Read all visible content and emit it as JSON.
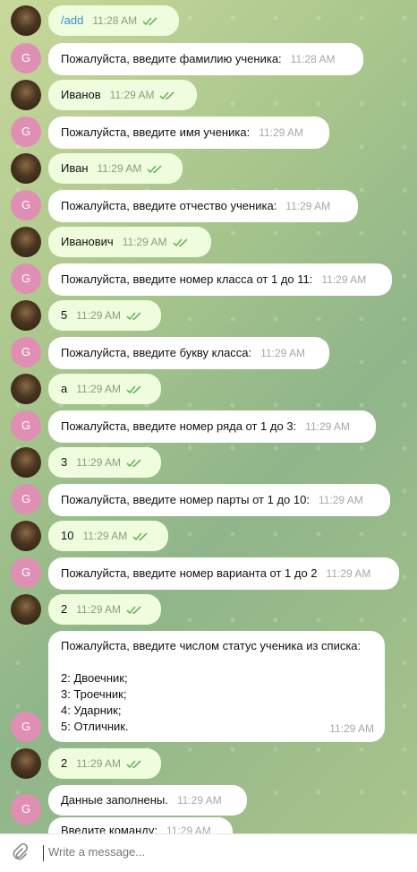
{
  "colors": {
    "bubble_out": "#effdde",
    "bubble_in": "#ffffff",
    "bot_avatar": "#e08fb4",
    "command_link": "#3a8ad6",
    "check_marks": "#6cb35c"
  },
  "bot_avatar_letter": "G",
  "messages": [
    {
      "dir": "out",
      "text": "/add",
      "time": "11:28 AM"
    },
    {
      "dir": "in",
      "text": "Пожалуйста, введите фамилию ученика:",
      "time": "11:28 AM"
    },
    {
      "dir": "out",
      "text": "Иванов",
      "time": "11:29 AM"
    },
    {
      "dir": "in",
      "text": "Пожалуйста, введите имя ученика:",
      "time": "11:29 AM"
    },
    {
      "dir": "out",
      "text": "Иван",
      "time": "11:29 AM"
    },
    {
      "dir": "in",
      "text": "Пожалуйста, введите отчество ученика:",
      "time": "11:29 AM"
    },
    {
      "dir": "out",
      "text": "Иванович",
      "time": "11:29 AM"
    },
    {
      "dir": "in",
      "text": "Пожалуйста, введите номер класса от 1 до 11:",
      "time": "11:29 AM"
    },
    {
      "dir": "out",
      "text": "5",
      "time": "11:29 AM"
    },
    {
      "dir": "in",
      "text": "Пожалуйста, введите букву класса:",
      "time": "11:29 AM"
    },
    {
      "dir": "out",
      "text": "а",
      "time": "11:29 AM"
    },
    {
      "dir": "in",
      "text": "Пожалуйста, введите номер ряда от 1 до 3:",
      "time": "11:29 AM"
    },
    {
      "dir": "out",
      "text": "3",
      "time": "11:29 AM"
    },
    {
      "dir": "in",
      "text": "Пожалуйста, введите номер парты от 1 до 10:",
      "time": "11:29 AM"
    },
    {
      "dir": "out",
      "text": "10",
      "time": "11:29 AM"
    },
    {
      "dir": "in",
      "text": "Пожалуйста, введите номер варианта от 1 до 2",
      "time": "11:29 AM"
    },
    {
      "dir": "out",
      "text": "2",
      "time": "11:29 AM"
    },
    {
      "dir": "in",
      "lines": [
        "Пожалуйста, введите числом статус ученика из списка:",
        "",
        "2: Двоечник;",
        "3: Троечник;",
        "4: Ударник;",
        "5: Отличник."
      ],
      "time": "11:29 AM"
    },
    {
      "dir": "out",
      "text": "2",
      "time": "11:29 AM"
    },
    {
      "dir": "in",
      "text": "Данные заполнены.",
      "time": "11:29 AM"
    },
    {
      "dir": "in",
      "text": "Введите команду:",
      "time": "11:29 AM"
    }
  ],
  "composer": {
    "placeholder": "Write a message..."
  }
}
